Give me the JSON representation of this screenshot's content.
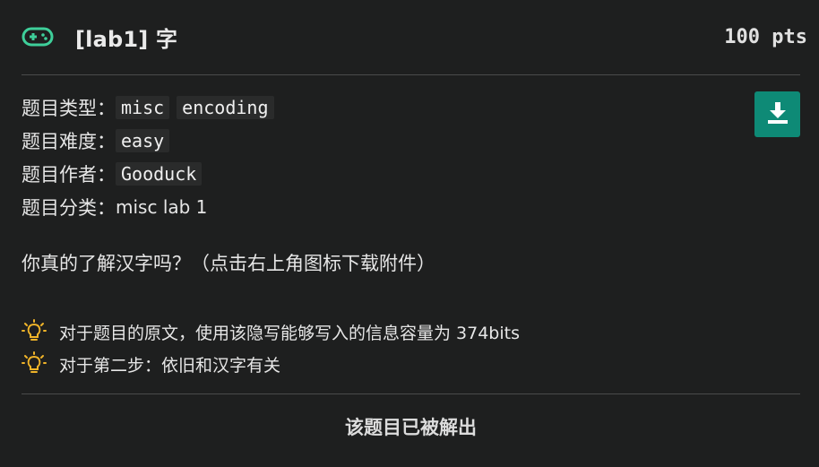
{
  "challenge": {
    "title": "[lab1] 字",
    "points": "100 pts",
    "icon": "gamepad-icon",
    "accent_color": "#3ecf9a"
  },
  "meta": {
    "type_label": "题目类型：",
    "type_tags": [
      "misc",
      "encoding"
    ],
    "difficulty_label": "题目难度：",
    "difficulty": "easy",
    "author_label": "题目作者：",
    "author": "Gooduck",
    "category_label": "题目分类：",
    "category": "misc lab 1"
  },
  "download": {
    "icon": "download-icon",
    "color": "#0e8a76"
  },
  "description": "你真的了解汉字吗？（点击右上角图标下载附件）",
  "hints": [
    {
      "icon": "lightbulb-icon",
      "text": "对于题目的原文，使用该隐写能够写入的信息容量为 374bits"
    },
    {
      "icon": "lightbulb-icon",
      "text": "对于第二步：依旧和汉字有关"
    }
  ],
  "hint_icon_color": "#f0b429",
  "status": "该题目已被解出"
}
